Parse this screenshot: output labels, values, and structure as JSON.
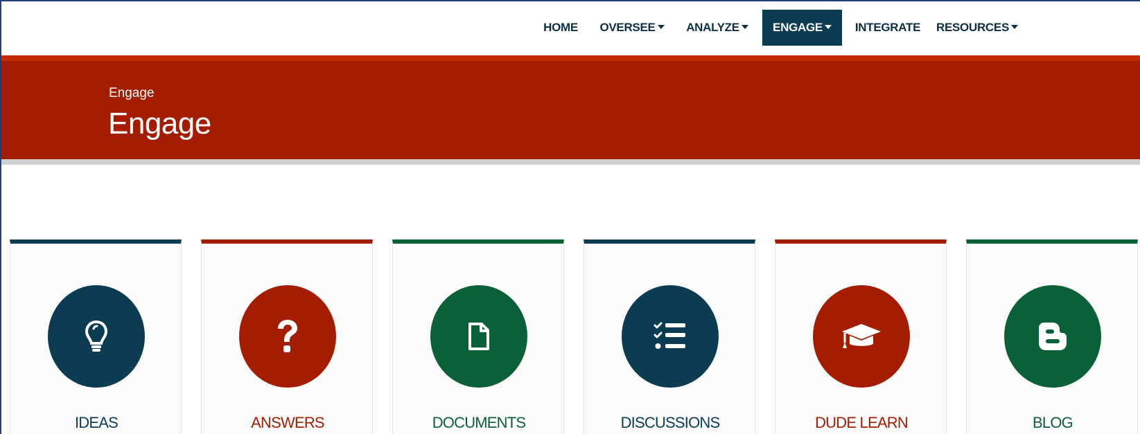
{
  "nav": {
    "items": [
      {
        "label": "HOME",
        "has_dropdown": false,
        "active": false
      },
      {
        "label": "OVERSEE",
        "has_dropdown": true,
        "active": false
      },
      {
        "label": "ANALYZE",
        "has_dropdown": true,
        "active": false
      },
      {
        "label": "ENGAGE",
        "has_dropdown": true,
        "active": true
      },
      {
        "label": "INTEGRATE",
        "has_dropdown": false,
        "active": false
      },
      {
        "label": "RESOURCES",
        "has_dropdown": true,
        "active": false
      }
    ]
  },
  "banner": {
    "breadcrumb": "Engage",
    "title": "Engage",
    "color": "#a51d00"
  },
  "cards": [
    {
      "label": "IDEAS",
      "icon": "lightbulb-icon",
      "color": "#0b3c52"
    },
    {
      "label": "ANSWERS",
      "icon": "question-icon",
      "color": "#a51d00"
    },
    {
      "label": "DOCUMENTS",
      "icon": "document-icon",
      "color": "#0a6037"
    },
    {
      "label": "DISCUSSIONS",
      "icon": "checklist-icon",
      "color": "#0b3c52"
    },
    {
      "label": "DUDE LEARN",
      "icon": "graduation-cap-icon",
      "color": "#a51d00"
    },
    {
      "label": "BLOG",
      "icon": "blogger-icon",
      "color": "#0a6037"
    }
  ],
  "colors": {
    "navy": "#0b3c52",
    "red": "#a51d00",
    "green": "#0a6037"
  }
}
